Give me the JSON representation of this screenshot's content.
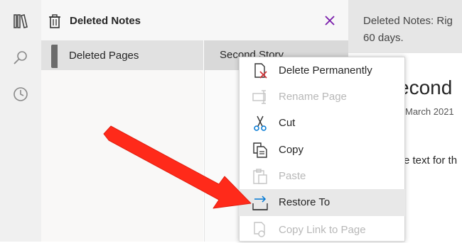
{
  "app": {
    "colors": {
      "accent": "#7719aa",
      "arrow": "#ff2a1a"
    }
  },
  "rail": {
    "icons": [
      "notebooks-icon",
      "search-icon",
      "recent-icon"
    ]
  },
  "deleted_panel": {
    "title": "Deleted Notes",
    "section": {
      "label": "Deleted Pages"
    },
    "page": {
      "label": "Second Story"
    }
  },
  "info_bar": {
    "line1": "Deleted Notes: Rig",
    "line2": "60 days."
  },
  "content": {
    "title": "econd",
    "date": "March 2021",
    "body": "e text for th"
  },
  "context_menu": {
    "items": [
      {
        "label": "Delete Permanently",
        "enabled": true,
        "icon": "delete-permanently-icon"
      },
      {
        "label": "Rename Page",
        "enabled": false,
        "icon": "rename-icon"
      },
      {
        "label": "Cut",
        "enabled": true,
        "icon": "scissors-icon"
      },
      {
        "label": "Copy",
        "enabled": true,
        "icon": "copy-icon"
      },
      {
        "label": "Paste",
        "enabled": false,
        "icon": "paste-icon"
      },
      {
        "label": "Restore To",
        "enabled": true,
        "icon": "restore-icon",
        "highlighted": true
      },
      {
        "label": "Copy Link to Page",
        "enabled": false,
        "icon": "link-icon"
      }
    ]
  }
}
